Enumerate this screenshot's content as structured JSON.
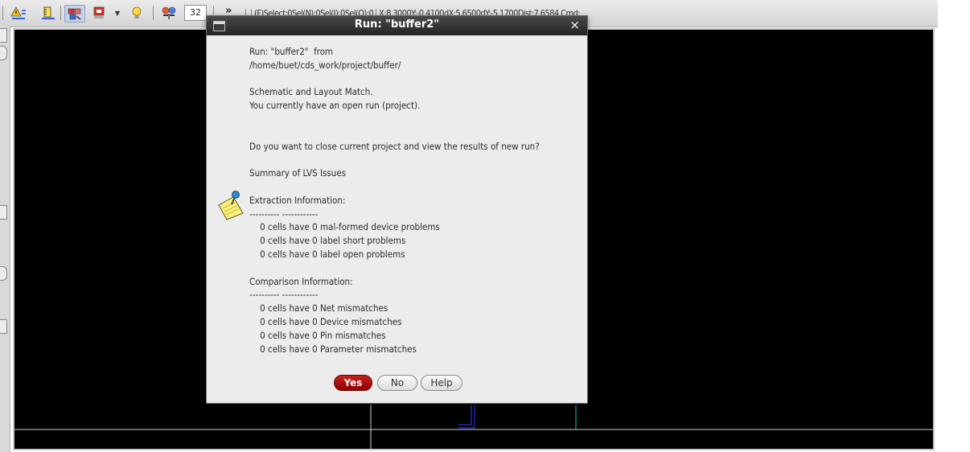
{
  "toolbar": {
    "zoom_value": "32",
    "overflow_label": "»",
    "status": {
      "select": "(F)Select:0",
      "sel_n": "Sel(N):0",
      "sel_i": "Sel(I):0",
      "sel_o": "Sel(O):0",
      "x": "X:8.3000",
      "y": "Y:-0.4100",
      "dx": "dX:5.6500",
      "dy": "dY:-5.1700",
      "dist": "Dist:7.6584",
      "cmd": "Cmd:"
    }
  },
  "dialog": {
    "title": "Run: \"buffer2\"",
    "close_label": "×",
    "message": "Run: \"buffer2\"  from\n/home/buet/cds_work/project/buffer/\n\nSchematic and Layout Match.\nYou currently have an open run (project).\n\n\nDo you want to close current project and view the results of new run?\n\nSummary of LVS Issues\n\nExtraction Information:\n---------- ------------\n    0 cells have 0 mal-formed device problems\n    0 cells have 0 label short problems\n    0 cells have 0 label open problems\n\nComparison Information:\n---------- ------------\n    0 cells have 0 Net mismatches\n    0 cells have 0 Device mismatches\n    0 cells have 0 Pin mismatches\n    0 cells have 0 Parameter mismatches",
    "buttons": {
      "yes": "Yes",
      "no": "No",
      "help": "Help"
    }
  },
  "colors": {
    "canvas_bg": "#000000",
    "yes_button": "#b0100c",
    "titlebar": "#2e2e2e",
    "layout_blue": "#2a3cff",
    "layout_cyan": "#19c8c8"
  },
  "icons": [
    "warning-bulb-icon",
    "ruler-icon",
    "layer-icon",
    "display-icon",
    "lightbulb-icon",
    "tool-icon",
    "note-pin-icon",
    "window-menu-icon"
  ]
}
